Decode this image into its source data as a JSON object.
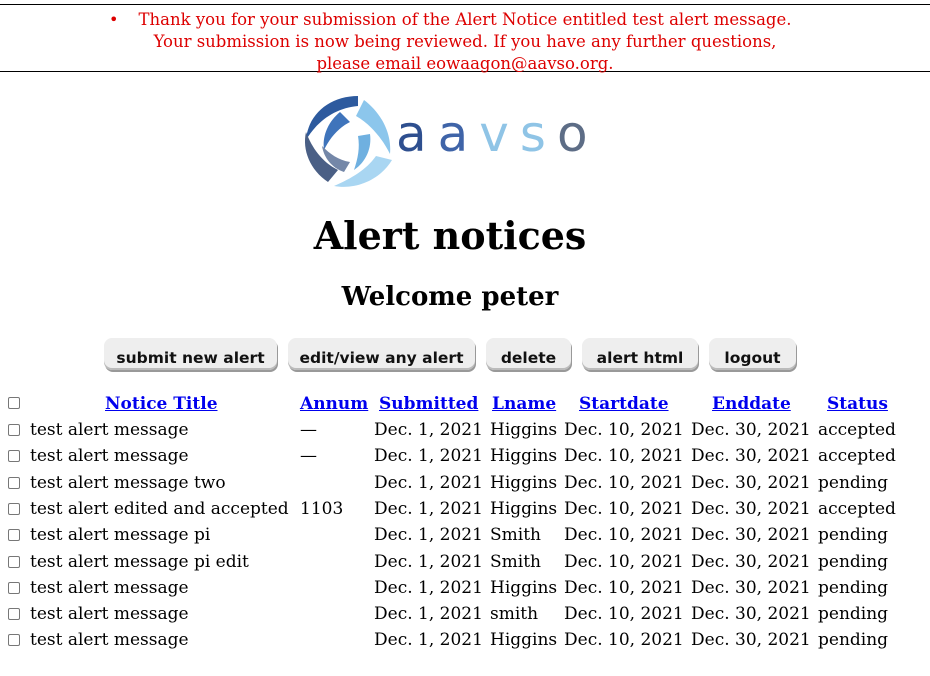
{
  "flash": {
    "bullet": "•",
    "line1": "Thank you for your submission of the Alert Notice entitled test alert message.",
    "line2": "Your submission is now being reviewed. If you have any further questions,",
    "line3": "please email eowaagon@aavso.org."
  },
  "logo": {
    "letters": [
      "a",
      "a",
      "v",
      "s",
      "o"
    ]
  },
  "page": {
    "title": "Alert notices",
    "welcome": "Welcome peter"
  },
  "actions": {
    "submit": "submit new alert",
    "edit": "edit/view any alert",
    "delete": "delete",
    "html": "alert html",
    "logout": "logout"
  },
  "table": {
    "headers": {
      "title": "Notice Title",
      "annum": "Annum",
      "submitted": "Submitted",
      "lname": "Lname",
      "startdate": "Startdate",
      "enddate": "Enddate",
      "status": "Status"
    },
    "rows": [
      {
        "title": "test alert message",
        "annum": "—",
        "submitted": "Dec. 1, 2021",
        "lname": "Higgins",
        "startdate": "Dec. 10, 2021",
        "enddate": "Dec. 30, 2021",
        "status": "accepted"
      },
      {
        "title": "test alert message",
        "annum": "—",
        "submitted": "Dec. 1, 2021",
        "lname": "Higgins",
        "startdate": "Dec. 10, 2021",
        "enddate": "Dec. 30, 2021",
        "status": "accepted"
      },
      {
        "title": "test alert message two",
        "annum": "",
        "submitted": "Dec. 1, 2021",
        "lname": "Higgins",
        "startdate": "Dec. 10, 2021",
        "enddate": "Dec. 30, 2021",
        "status": "pending"
      },
      {
        "title": "test alert edited and accepted",
        "annum": "1103",
        "submitted": "Dec. 1, 2021",
        "lname": "Higgins",
        "startdate": "Dec. 10, 2021",
        "enddate": "Dec. 30, 2021",
        "status": "accepted"
      },
      {
        "title": "test alert message pi",
        "annum": "",
        "submitted": "Dec. 1, 2021",
        "lname": "Smith",
        "startdate": "Dec. 10, 2021",
        "enddate": "Dec. 30, 2021",
        "status": "pending"
      },
      {
        "title": "test alert message pi edit",
        "annum": "",
        "submitted": "Dec. 1, 2021",
        "lname": "Smith",
        "startdate": "Dec. 10, 2021",
        "enddate": "Dec. 30, 2021",
        "status": "pending"
      },
      {
        "title": "test alert message",
        "annum": "",
        "submitted": "Dec. 1, 2021",
        "lname": "Higgins",
        "startdate": "Dec. 10, 2021",
        "enddate": "Dec. 30, 2021",
        "status": "pending"
      },
      {
        "title": "test alert message",
        "annum": "",
        "submitted": "Dec. 1, 2021",
        "lname": "smith",
        "startdate": "Dec. 10, 2021",
        "enddate": "Dec. 30, 2021",
        "status": "pending"
      },
      {
        "title": "test alert message",
        "annum": "",
        "submitted": "Dec. 1, 2021",
        "lname": "Higgins",
        "startdate": "Dec. 10, 2021",
        "enddate": "Dec. 30, 2021",
        "status": "pending"
      }
    ]
  },
  "colors": {
    "flash": "#dd0000",
    "link": "#0000ee"
  }
}
